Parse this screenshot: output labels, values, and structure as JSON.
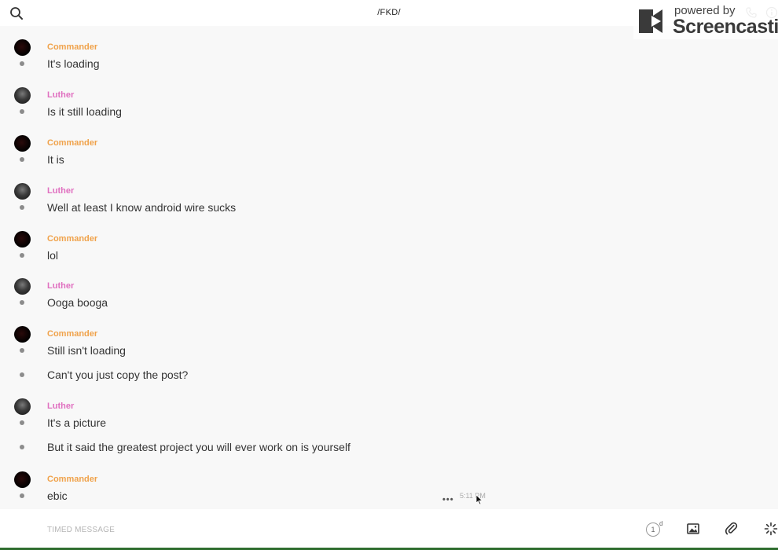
{
  "topbar": {
    "title": "/FKD/",
    "search_icon": "search-icon",
    "right_icons": [
      "phone-icon",
      "info-icon"
    ]
  },
  "watermark": {
    "powered_by": "powered by",
    "brand": "Screencastify"
  },
  "colors": {
    "commander": "#f0a24a",
    "luther": "#e070c0",
    "dot": "#8c8c8c"
  },
  "messages": [
    {
      "sender": "Commander",
      "texts": [
        "It's loading"
      ]
    },
    {
      "sender": "Luther",
      "texts": [
        "Is it still loading"
      ]
    },
    {
      "sender": "Commander",
      "texts": [
        "It is"
      ]
    },
    {
      "sender": "Luther",
      "texts": [
        "Well at least I know android wire sucks"
      ]
    },
    {
      "sender": "Commander",
      "texts": [
        "lol"
      ]
    },
    {
      "sender": "Luther",
      "texts": [
        "Ooga booga"
      ]
    },
    {
      "sender": "Commander",
      "texts": [
        "Still isn't loading",
        "Can't you just copy the post?"
      ]
    },
    {
      "sender": "Luther",
      "texts": [
        "It's a picture",
        "But it said the greatest project you will ever work on is yourself"
      ]
    },
    {
      "sender": "Commander",
      "texts": [
        "ebic"
      ]
    }
  ],
  "last_message_meta": {
    "more": "•••",
    "time": "5:11 PM"
  },
  "footer": {
    "input_placeholder": "TIMED MESSAGE",
    "input_value": "",
    "timer_value": "1",
    "timer_unit": "d",
    "icons": [
      "timer-icon",
      "image-icon",
      "paperclip-icon",
      "sparkle-icon"
    ]
  }
}
